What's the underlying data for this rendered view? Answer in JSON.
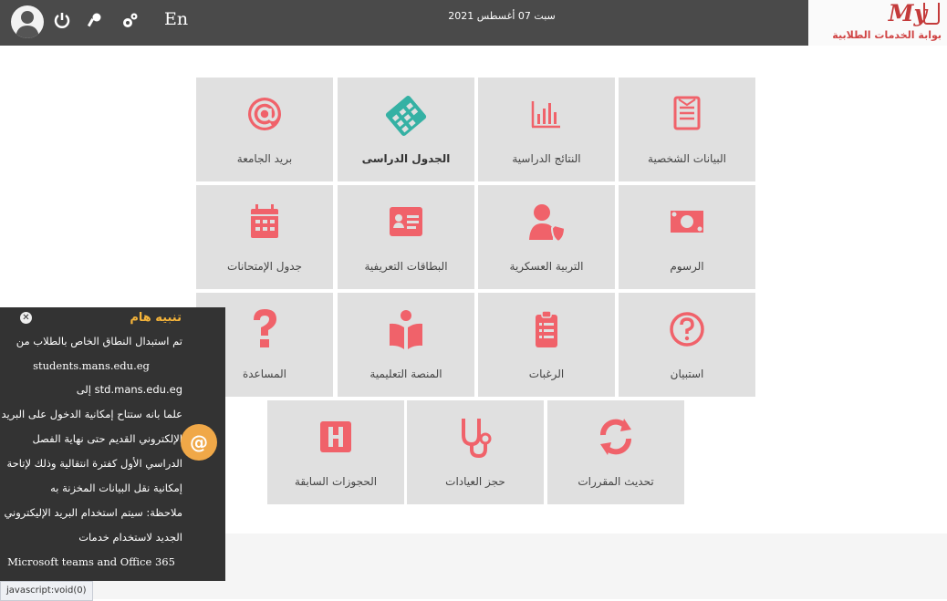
{
  "topbar": {
    "lang_label": "En",
    "date_text": "سبت 07 أغسطس 2021",
    "icons": [
      "user-avatar",
      "power-icon",
      "key-icon",
      "settings-icon"
    ],
    "brand_logo": "My",
    "brand_text": "بوابة الخدمات الطلابية"
  },
  "tiles": [
    {
      "label": "البيانات الشخصية",
      "icon": "profile-doc-icon"
    },
    {
      "label": "النتائج الدراسية",
      "icon": "bar-chart-icon"
    },
    {
      "label": "الجدول الدراسى",
      "icon": "calendar-icon"
    },
    {
      "label": "بريد الجامعة",
      "icon": "at-icon"
    },
    {
      "label": "الرسوم",
      "icon": "money-icon"
    },
    {
      "label": "التربية العسكرية",
      "icon": "user-shield-icon"
    },
    {
      "label": "البطاقات التعريفية",
      "icon": "id-card-icon"
    },
    {
      "label": "جدول الإمتحانات",
      "icon": "exam-calendar-icon"
    },
    {
      "label": "استبيان",
      "icon": "question-circle-icon"
    },
    {
      "label": "الرغبات",
      "icon": "clipboard-list-icon"
    },
    {
      "label": "المنصة التعليمية",
      "icon": "reading-icon"
    },
    {
      "label": "المساعدة",
      "icon": "question-icon"
    },
    {
      "label": "تحديث المقررات",
      "icon": "refresh-icon"
    },
    {
      "label": "حجز العيادات",
      "icon": "stethoscope-icon"
    },
    {
      "label": "الحجوزات السابقة",
      "icon": "hospital-icon"
    }
  ],
  "notice": {
    "title": "تنبيه هام",
    "lines": [
      "تم استبدال النطاق الخاص بالطلاب من",
      "students.mans.edu.eg",
      "إلى std.mans.edu.eg",
      "علما بانه ستتاح إمكانية الدخول على البريد",
      "الإلكتروني القديم حتى نهاية الفصل",
      "الدراسي الأول كفترة انتقالية وذلك لإتاحة",
      "إمكانية نقل البيانات المخزنة به",
      "ملاحظة: سيتم استخدام البريد الإليكتروني",
      "الجديد لاستخدام خدمات",
      "Microsoft teams and Office 365"
    ],
    "badge_icon": "at-icon",
    "close_icon": "close-icon"
  },
  "status_bar": {
    "text": "javascript:void(0)"
  },
  "colors": {
    "accent": "#f0626a",
    "tile_bg": "#e0e0e0",
    "calendar_accent": "#35b1a4",
    "topbar": "#4a4a4a",
    "notice_bg": "#333333",
    "notice_title": "#f5b43a"
  }
}
